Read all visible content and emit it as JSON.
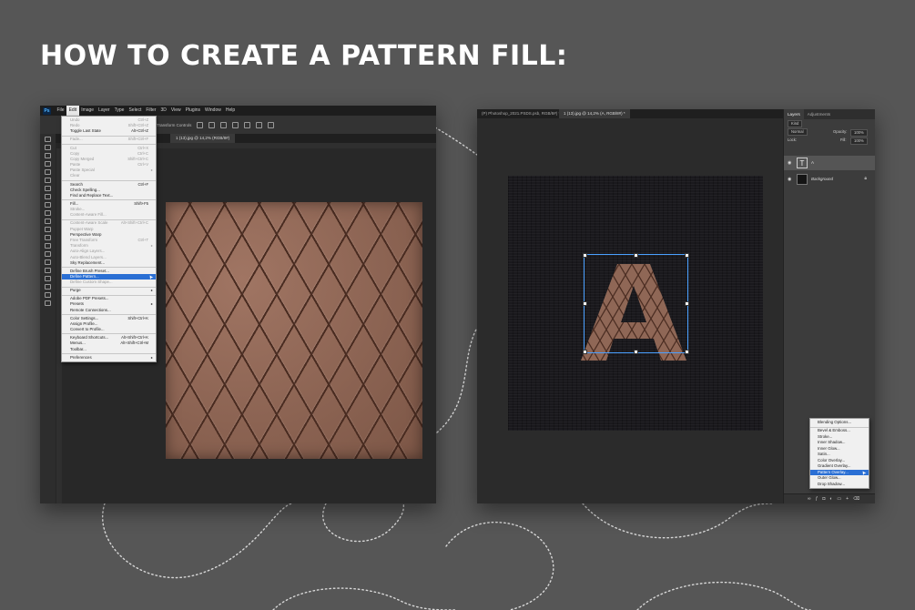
{
  "headline": "HOW TO CREATE A PATTERN FILL:",
  "left_window": {
    "logo": "Ps",
    "menus": [
      "File",
      "Edit",
      "Image",
      "Layer",
      "Type",
      "Select",
      "Filter",
      "3D",
      "View",
      "Plugins",
      "Window",
      "Help"
    ],
    "active_menu": "Edit",
    "options_label": "Transform Controls",
    "document_tab": "1 (13).jpg @ 14,2% (RGB/8#)",
    "edit_menu": [
      {
        "label": "Undo",
        "shortcut": "Ctrl+Z",
        "disabled": true
      },
      {
        "label": "Redo",
        "shortcut": "Shift+Ctrl+Z",
        "disabled": true
      },
      {
        "label": "Toggle Last State",
        "shortcut": "Alt+Ctrl+Z",
        "disabled": false
      },
      {
        "sep": true
      },
      {
        "label": "Fade...",
        "shortcut": "Shift+Ctrl+F",
        "disabled": true
      },
      {
        "sep": true
      },
      {
        "label": "Cut",
        "shortcut": "Ctrl+X",
        "disabled": true
      },
      {
        "label": "Copy",
        "shortcut": "Ctrl+C",
        "disabled": true
      },
      {
        "label": "Copy Merged",
        "shortcut": "Shift+Ctrl+C",
        "disabled": true
      },
      {
        "label": "Paste",
        "shortcut": "Ctrl+V",
        "disabled": true
      },
      {
        "label": "Paste Special",
        "shortcut": "",
        "disabled": true,
        "arrow": true
      },
      {
        "label": "Clear",
        "shortcut": "",
        "disabled": true
      },
      {
        "sep": true
      },
      {
        "label": "Search",
        "shortcut": "Ctrl+F",
        "disabled": false
      },
      {
        "label": "Check Spelling...",
        "shortcut": "",
        "disabled": false
      },
      {
        "label": "Find and Replace Text...",
        "shortcut": "",
        "disabled": false
      },
      {
        "sep": true
      },
      {
        "label": "Fill...",
        "shortcut": "Shift+F5",
        "disabled": false
      },
      {
        "label": "Stroke...",
        "shortcut": "",
        "disabled": true
      },
      {
        "label": "Content-Aware Fill...",
        "shortcut": "",
        "disabled": true
      },
      {
        "sep": true
      },
      {
        "label": "Content-Aware Scale",
        "shortcut": "Alt+Shift+Ctrl+C",
        "disabled": true
      },
      {
        "label": "Puppet Warp",
        "shortcut": "",
        "disabled": true
      },
      {
        "label": "Perspective Warp",
        "shortcut": "",
        "disabled": false
      },
      {
        "label": "Free Transform",
        "shortcut": "Ctrl+T",
        "disabled": true
      },
      {
        "label": "Transform",
        "shortcut": "",
        "disabled": true,
        "arrow": true
      },
      {
        "label": "Auto-Align Layers...",
        "shortcut": "",
        "disabled": true
      },
      {
        "label": "Auto-Blend Layers...",
        "shortcut": "",
        "disabled": true
      },
      {
        "label": "Sky Replacement...",
        "shortcut": "",
        "disabled": false
      },
      {
        "sep": true
      },
      {
        "label": "Define Brush Preset...",
        "shortcut": "",
        "disabled": false
      },
      {
        "label": "Define Pattern...",
        "shortcut": "",
        "disabled": false,
        "selected": true
      },
      {
        "label": "Define Custom Shape...",
        "shortcut": "",
        "disabled": true
      },
      {
        "sep": true
      },
      {
        "label": "Purge",
        "shortcut": "",
        "disabled": false,
        "arrow": true
      },
      {
        "sep": true
      },
      {
        "label": "Adobe PDF Presets...",
        "shortcut": "",
        "disabled": false
      },
      {
        "label": "Presets",
        "shortcut": "",
        "disabled": false,
        "arrow": true
      },
      {
        "label": "Remote Connections...",
        "shortcut": "",
        "disabled": false
      },
      {
        "sep": true
      },
      {
        "label": "Color Settings...",
        "shortcut": "Shift+Ctrl+K",
        "disabled": false
      },
      {
        "label": "Assign Profile...",
        "shortcut": "",
        "disabled": false
      },
      {
        "label": "Convert to Profile...",
        "shortcut": "",
        "disabled": false
      },
      {
        "sep": true
      },
      {
        "label": "Keyboard Shortcuts...",
        "shortcut": "Alt+Shift+Ctrl+K",
        "disabled": false
      },
      {
        "label": "Menus...",
        "shortcut": "Alt+Shift+Ctrl+M",
        "disabled": false
      },
      {
        "label": "Toolbar...",
        "shortcut": "",
        "disabled": false
      },
      {
        "sep": true
      },
      {
        "label": "Preferences",
        "shortcut": "",
        "disabled": false,
        "arrow": true
      }
    ]
  },
  "right_window": {
    "tabs": [
      {
        "label": "(P) Photoshop_2021.PSDS.psb, RGB/8#) *",
        "active": false
      },
      {
        "label": "1 (13).jpg @ 14,2% (A, RGB/8#) *",
        "active": true
      }
    ],
    "canvas_letter": "A",
    "panel_tabs": [
      "Layers",
      "Adjustments"
    ],
    "kind_label": "Kind",
    "blend_mode": "Normal",
    "opacity_label": "Opacity:",
    "opacity_value": "100%",
    "lock_label": "Lock:",
    "fill_label": "Fill:",
    "fill_value": "100%",
    "layers": [
      {
        "name": "A",
        "type": "text"
      },
      {
        "name": "Background",
        "type": "image"
      }
    ],
    "fx_menu": [
      {
        "label": "Blending Options...",
        "selected": false
      },
      {
        "sep": true
      },
      {
        "label": "Bevel & Emboss...",
        "selected": false
      },
      {
        "label": "Stroke...",
        "selected": false
      },
      {
        "label": "Inner Shadow...",
        "selected": false
      },
      {
        "label": "Inner Glow...",
        "selected": false
      },
      {
        "label": "Satin...",
        "selected": false
      },
      {
        "label": "Color Overlay...",
        "selected": false
      },
      {
        "label": "Gradient Overlay...",
        "selected": false
      },
      {
        "label": "Pattern Overlay...",
        "selected": true
      },
      {
        "label": "Outer Glow...",
        "selected": false
      },
      {
        "label": "Drop Shadow...",
        "selected": false
      }
    ]
  },
  "colors": {
    "background": "#565656",
    "selection_blue": "#2a6fd4",
    "leather": "#8d6553",
    "transform_box": "#4aa0ff"
  }
}
